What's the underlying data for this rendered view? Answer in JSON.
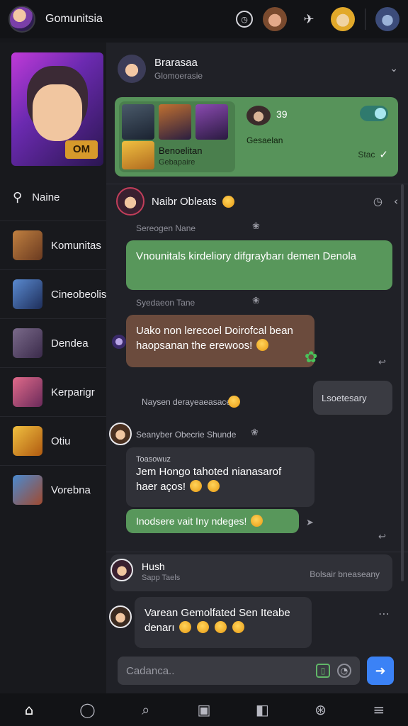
{
  "app": {
    "title": "Gomunitsia"
  },
  "topbar": {
    "icons": [
      "profile-avatar",
      "compass-icon",
      "friend-avatar-1",
      "plane-icon",
      "friend-avatar-2",
      "friend-avatar-3"
    ]
  },
  "sidebar": {
    "hero_badge": "OM",
    "search_label": "Naine",
    "items": [
      {
        "label": "Komunitas",
        "color": "#b06a3a"
      },
      {
        "label": "Cineobeolis",
        "color": "#3a6ab0"
      },
      {
        "label": "Dendea",
        "color": "#5a4a6a"
      },
      {
        "label": "Kerparigr",
        "color": "#c04a6a"
      },
      {
        "label": "Otiu",
        "color": "#e0a020"
      },
      {
        "label": "Vorebna",
        "color": "#2a6ab0"
      }
    ]
  },
  "group": {
    "name": "Brarasaa",
    "subtitle": "Glomoerasie"
  },
  "promo": {
    "card_title": "Benoelitan",
    "card_subtitle": "Gebapaire",
    "count": "39",
    "label": "Gesaelan",
    "action": "Stac",
    "toggle_on": true,
    "accent": "#57935a"
  },
  "thread": {
    "name": "Naibr Obleats"
  },
  "messages": [
    {
      "meta": "Sereogen Nane",
      "text": "Vnounitals kirdeliory difgraybarı demen Denola"
    },
    {
      "meta": "Syedaeon Tane",
      "text": "Uako non lerecoel Doirofcal bean haopsanan the erewoos!"
    },
    {
      "meta": "Naysen derayeaeasace",
      "text": "Lsoetesary"
    },
    {
      "meta": "Seanyber Obecrie Shunde",
      "tag": "Toasowuz",
      "text": "Jem Hongo tahoted nianasarof haer aços!"
    },
    {
      "text": "Inodsere vait Iny ndeges!"
    }
  ],
  "pinned": [
    {
      "name": "Hush",
      "sub": "Sapp Taels",
      "note": "Bolsair bneaseany"
    },
    {
      "text": "Varean Gemolfated Sen Iteabe denarı"
    }
  ],
  "composer": {
    "placeholder": "Cadanca..",
    "send_icon": "send-icon"
  },
  "bottom_nav": [
    {
      "icon": "home-icon",
      "glyph": "⌂",
      "active": true
    },
    {
      "icon": "profile-icon",
      "glyph": "◯"
    },
    {
      "icon": "search-icon",
      "glyph": "⌕"
    },
    {
      "icon": "chat-icon",
      "glyph": "▣"
    },
    {
      "icon": "bag-icon",
      "glyph": "◧"
    },
    {
      "icon": "game-icon",
      "glyph": "⊛"
    },
    {
      "icon": "menu-icon",
      "glyph": "≡"
    }
  ]
}
